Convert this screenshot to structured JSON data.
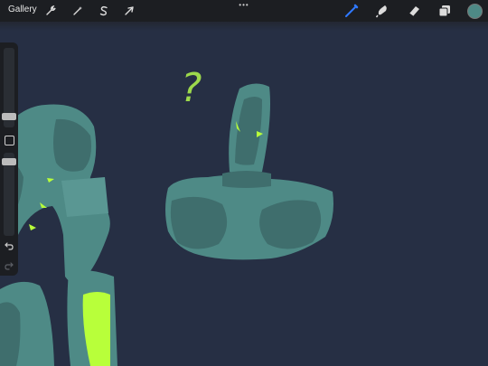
{
  "app": {
    "gallery_label": "Gallery",
    "more_menu_glyph": "•••",
    "current_color": "#4e8a86"
  },
  "toolbar_left": [
    {
      "name": "actions-wrench-icon"
    },
    {
      "name": "adjustments-magic-wand-icon"
    },
    {
      "name": "selection-s-icon"
    },
    {
      "name": "transform-arrow-icon"
    }
  ],
  "toolbar_right": [
    {
      "name": "brush-icon",
      "active": true,
      "color": "#2f79ff"
    },
    {
      "name": "smudge-icon",
      "active": false
    },
    {
      "name": "eraser-icon",
      "active": false
    },
    {
      "name": "layers-icon",
      "active": false
    }
  ],
  "canvas": {
    "background": "#262f44",
    "question_mark": "?",
    "question_color": "#9dd94c",
    "figure_color": "#4e8a86",
    "figure_shadow": "#3f6e6d",
    "highlight_color": "#b8ff3a"
  }
}
